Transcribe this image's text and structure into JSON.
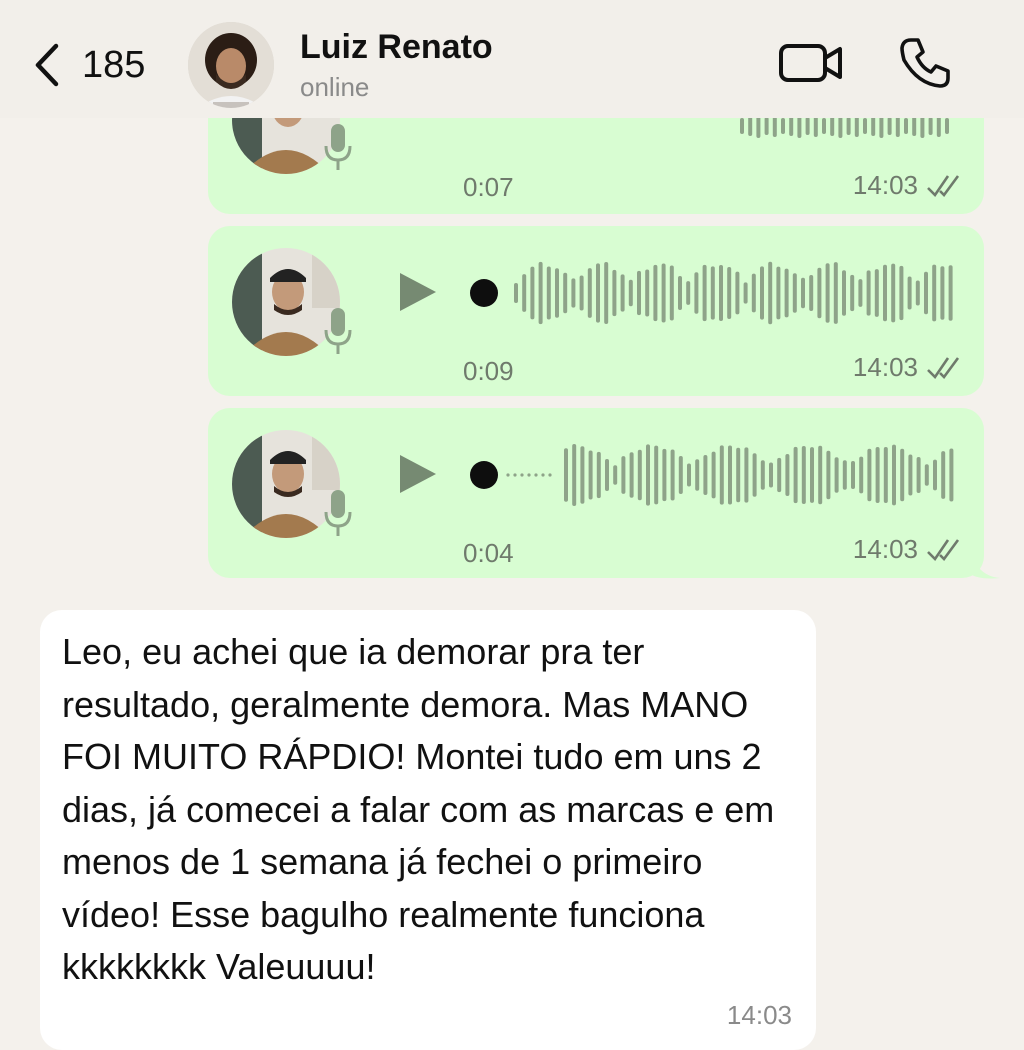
{
  "header": {
    "unread_count": "185",
    "contact_name": "Luiz Renato",
    "contact_status": "online"
  },
  "voice_messages": [
    {
      "duration": "0:07",
      "time": "14:03",
      "status": "read"
    },
    {
      "duration": "0:09",
      "time": "14:03",
      "status": "read"
    },
    {
      "duration": "0:04",
      "time": "14:03",
      "status": "read"
    }
  ],
  "incoming_message": {
    "text": "Leo, eu achei que ia demorar pra ter resultado, geralmente demora. Mas MANO FOI MUITO RÁPDIO! Montei tudo em uns 2 dias, já comecei a falar com as marcas e em menos de 1 semana já fechei o primeiro vídeo! Esse bagulho realmente funciona kkkkkkkk Valeuuuu!",
    "time": "14:03"
  },
  "icons": {
    "back": "chevron-left-icon",
    "video": "video-camera-icon",
    "call": "phone-icon",
    "mic": "microphone-icon",
    "play": "play-icon",
    "read": "double-check-icon"
  },
  "colors": {
    "chat_background": "#f4f1ec",
    "outgoing_bubble": "#d8fdd2",
    "incoming_bubble": "#ffffff",
    "waveform": "#8ea389"
  }
}
